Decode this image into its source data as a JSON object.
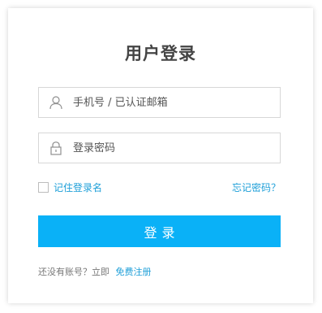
{
  "login": {
    "title": "用户登录",
    "phone_placeholder": "手机号 / 已认证邮箱",
    "password_placeholder": "登录密码",
    "remember_label": "记住登录名",
    "forgot_label": "忘记密码？",
    "submit_label": "登录",
    "footer_text": "还没有账号？立即",
    "register_label": "免费注册"
  },
  "colors": {
    "accent": "#0ab1f7",
    "link": "#1e9fd8",
    "title": "#444444"
  },
  "icons": {
    "phone_field": "user-icon",
    "password_field": "lock-icon"
  }
}
